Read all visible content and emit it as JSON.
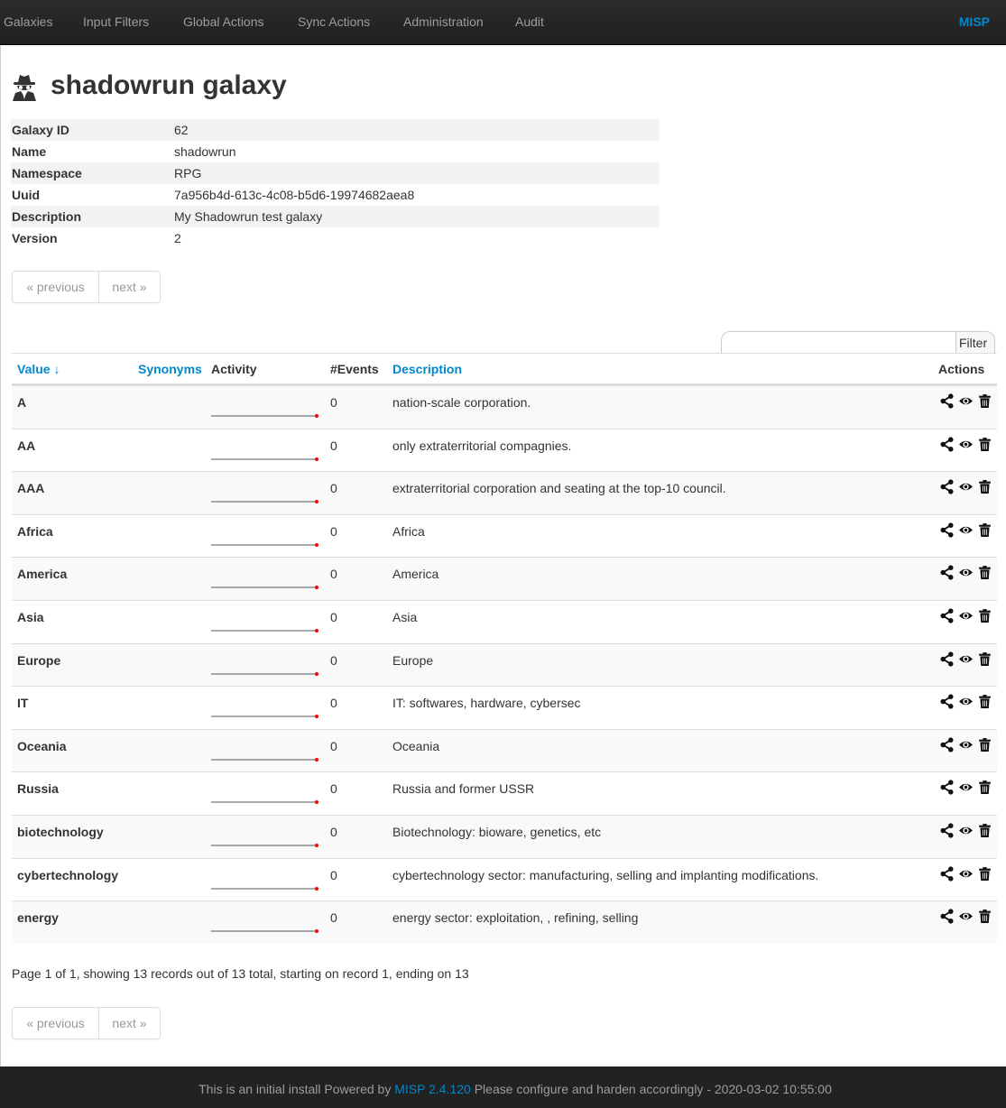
{
  "navbar": {
    "items": [
      "Galaxies",
      "Input Filters",
      "Global Actions",
      "Sync Actions",
      "Administration",
      "Audit"
    ],
    "brand": "MISP"
  },
  "page": {
    "title": "shadowrun galaxy",
    "title_icon": "user-secret-icon"
  },
  "meta": [
    {
      "key": "Galaxy ID",
      "value": "62"
    },
    {
      "key": "Name",
      "value": "shadowrun"
    },
    {
      "key": "Namespace",
      "value": "RPG"
    },
    {
      "key": "Uuid",
      "value": "7a956b4d-613c-4c08-b5d6-19974682aea8"
    },
    {
      "key": "Description",
      "value": "My Shadowrun test galaxy"
    },
    {
      "key": "Version",
      "value": "2"
    }
  ],
  "pager": {
    "previous": "« previous",
    "next": "next »"
  },
  "filter": {
    "label": "Filter",
    "value": ""
  },
  "table": {
    "headers": {
      "value": "Value ↓",
      "synonyms": "Synonyms",
      "activity": "Activity",
      "events": "#Events",
      "description": "Description",
      "actions": "Actions"
    },
    "rows": [
      {
        "value": "A",
        "events": "0",
        "description": "nation-scale corporation."
      },
      {
        "value": "AA",
        "events": "0",
        "description": "only extraterritorial compagnies."
      },
      {
        "value": "AAA",
        "events": "0",
        "description": "extraterritorial corporation and seating at the top-10 council."
      },
      {
        "value": "Africa",
        "events": "0",
        "description": "Africa"
      },
      {
        "value": "America",
        "events": "0",
        "description": "America"
      },
      {
        "value": "Asia",
        "events": "0",
        "description": "Asia"
      },
      {
        "value": "Europe",
        "events": "0",
        "description": "Europe"
      },
      {
        "value": "IT",
        "events": "0",
        "description": "IT: softwares, hardware, cybersec"
      },
      {
        "value": "Oceania",
        "events": "0",
        "description": "Oceania"
      },
      {
        "value": "Russia",
        "events": "0",
        "description": "Russia and former USSR"
      },
      {
        "value": "biotechnology",
        "events": "0",
        "description": "Biotechnology: bioware, genetics, etc"
      },
      {
        "value": "cybertechnology",
        "events": "0",
        "description": "cybertechnology sector: manufacturing, selling and implanting modifications."
      },
      {
        "value": "energy",
        "events": "0",
        "description": "energy sector: exploitation, , refining, selling"
      }
    ],
    "action_icons": [
      "share-icon",
      "eye-icon",
      "trash-icon"
    ]
  },
  "summary": "Page 1 of 1, showing 13 records out of 13 total, starting on record 1, ending on 13",
  "footer": {
    "prefix": "This is an initial install Powered by",
    "link": "MISP 2.4.120",
    "suffix": "Please configure and harden accordingly - 2020-03-02 10:55:00"
  },
  "colors": {
    "link": "#0088cc",
    "sparkline_dot": "#ff0000",
    "navbar_bg": "#222222"
  }
}
